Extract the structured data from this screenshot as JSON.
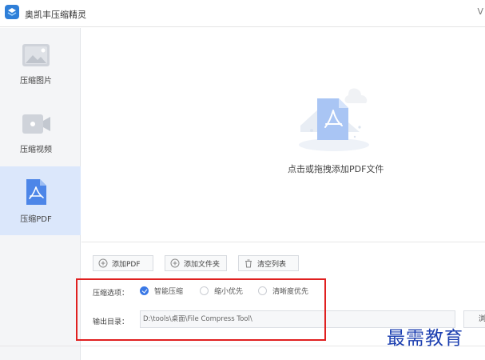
{
  "window": {
    "title": "奥凯丰压缩精灵",
    "edge_glyph": "V"
  },
  "sidebar": {
    "items": [
      {
        "label": "压缩图片",
        "icon": "image-icon",
        "active": false
      },
      {
        "label": "压缩视频",
        "icon": "video-camera-icon",
        "active": false
      },
      {
        "label": "压缩PDF",
        "icon": "pdf-file-icon",
        "active": true
      }
    ]
  },
  "drop_zone": {
    "text": "点击或拖拽添加PDF文件",
    "icon": "pdf-file-icon"
  },
  "toolbar": {
    "add_pdf": "添加PDF",
    "add_folder": "添加文件夹",
    "clear_list": "清空列表"
  },
  "options": {
    "label": "压缩选项：",
    "choices": [
      {
        "label": "智能压缩",
        "selected": true
      },
      {
        "label": "缩小优先",
        "selected": false
      },
      {
        "label": "清晰度优先",
        "selected": false
      }
    ]
  },
  "output": {
    "label": "输出目录：",
    "path": "D:\\tools\\桌面\\File Compress Tool\\",
    "browse_label": "浏览"
  },
  "watermark": "最需教育",
  "colors": {
    "accent": "#3a78e6",
    "sidebar_active": "#dbe7fb",
    "highlight": "#e02020",
    "watermark": "#1c3fb0"
  }
}
